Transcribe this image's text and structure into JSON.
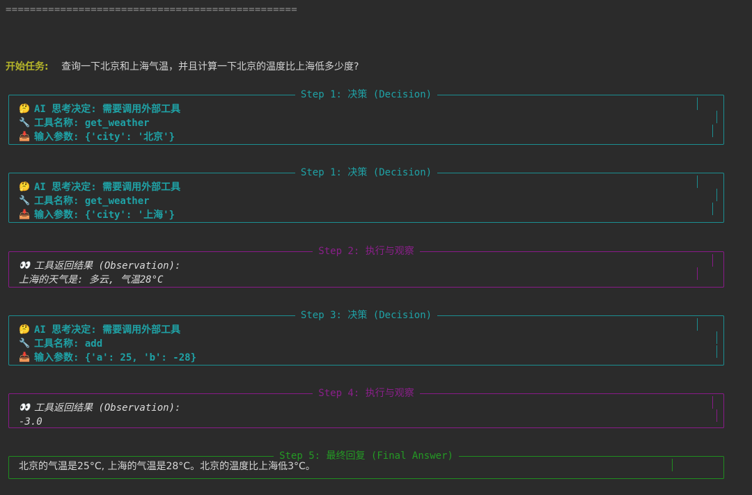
{
  "separator": "================================================",
  "task": {
    "label": "开始任务:",
    "text": "查询一下北京和上海气温，并且计算一下北京的温度比上海低多少度?"
  },
  "panels": [
    {
      "title": "Step 1: 决策 (Decision)",
      "lines": [
        "AI 思考决定: 需要调用外部工具",
        "工具名称: get_weather",
        "输入参数: {'city': '北京'}"
      ]
    },
    {
      "title": "Step 1: 决策 (Decision)",
      "lines": [
        "AI 思考决定: 需要调用外部工具",
        "工具名称: get_weather",
        "输入参数: {'city': '上海'}"
      ]
    },
    {
      "title": "Step 2: 执行与观察",
      "lines": [
        "工具返回结果 (Observation):",
        "上海的天气是: 多云, 气温28°C"
      ]
    },
    {
      "title": "Step 3: 决策 (Decision)",
      "lines": [
        "AI 思考决定: 需要调用外部工具",
        "工具名称: add",
        "输入参数: {'a': 25, 'b': -28}"
      ]
    },
    {
      "title": "Step 4: 执行与观察",
      "lines": [
        "工具返回结果 (Observation):",
        "-3.0"
      ]
    },
    {
      "title": "Step 5: 最终回复 (Final Answer)",
      "lines": [
        "北京的气温是25°C, 上海的气温是28°C。北京的温度比上海低3°C。"
      ]
    }
  ],
  "icons": {
    "thinking": "thinking-face-icon",
    "tool": "wrench-icon",
    "input": "inbox-tray-icon",
    "observe": "eyes-icon"
  }
}
